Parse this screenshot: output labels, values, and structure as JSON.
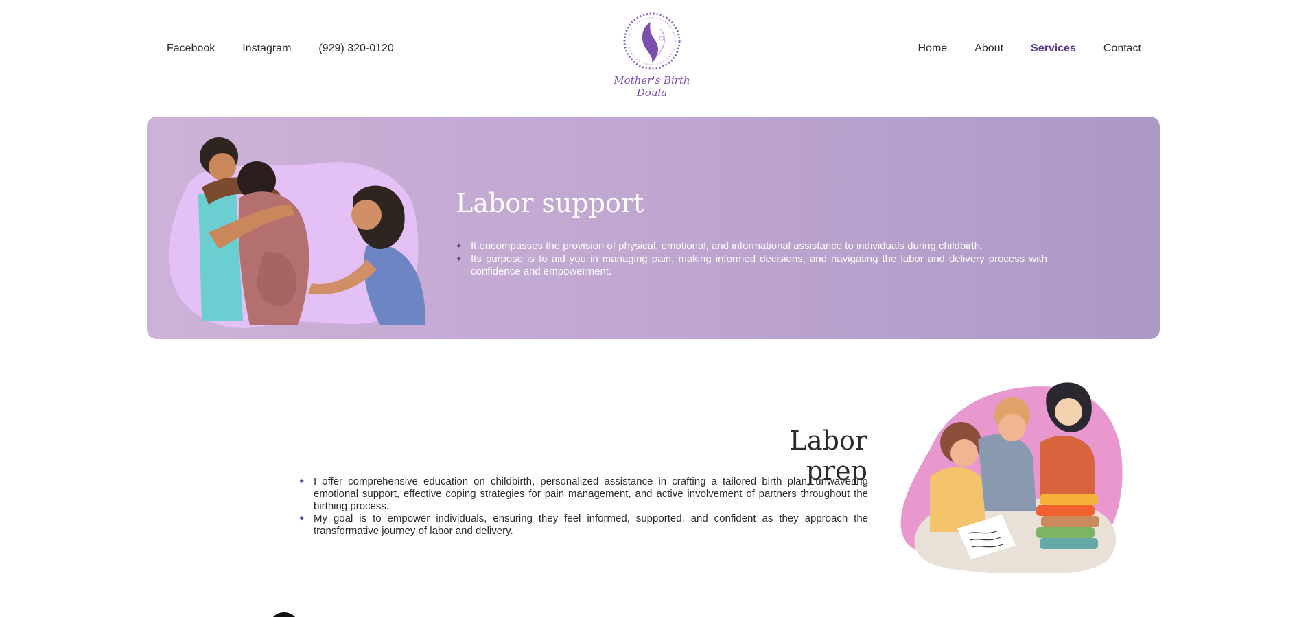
{
  "header": {
    "social": [
      "Facebook",
      "Instagram",
      "(929) 320-0120"
    ],
    "logo_text": "Mother's Birth Doula",
    "nav": [
      {
        "label": "Home",
        "active": false
      },
      {
        "label": "About",
        "active": false
      },
      {
        "label": "Services",
        "active": true
      },
      {
        "label": "Contact",
        "active": false
      }
    ]
  },
  "labor_support": {
    "title": "Labor support",
    "items": [
      "It encompasses the provision of physical, emotional, and informational assistance to individuals during childbirth.",
      "Its purpose is to aid you in managing pain, making informed decisions, and navigating the labor and delivery process with confidence and empowerment."
    ]
  },
  "labor_prep": {
    "title": "Labor prep",
    "items": [
      "I offer comprehensive education on childbirth, personalized assistance in crafting a tailored birth plan, unwavering emotional support, effective coping strategies for pain management, and active involvement of partners throughout the birthing process.",
      "My goal is to empower individuals, ensuring they feel informed, supported, and confident as they approach the transformative journey of labor and delivery."
    ]
  },
  "colors": {
    "accent": "#5b3a8c",
    "band_start": "#cdb2d8",
    "band_end": "#ad98c6"
  }
}
